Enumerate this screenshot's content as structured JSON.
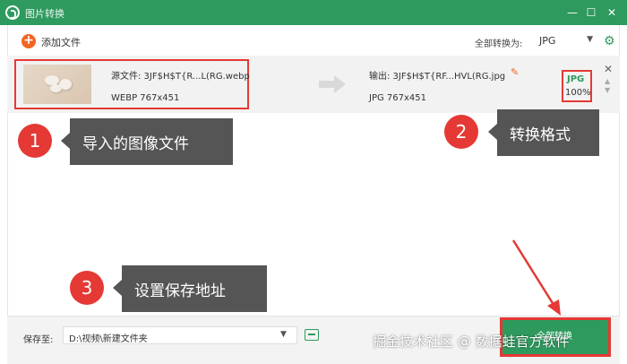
{
  "window": {
    "title": "图片转换",
    "minimize_glyph": "—",
    "maximize_glyph": "☐",
    "close_glyph": "✕"
  },
  "toolbar": {
    "add_icon_glyph": "+",
    "add_file_label": "添加文件",
    "convert_all_label": "全部转换为:",
    "format_value": "JPG",
    "format_caret": "▼",
    "settings_icon_glyph": "⚙"
  },
  "file": {
    "source_name": "源文件: 3JF$H$T{R...L(RG.webp",
    "source_meta": "WEBP   767x451",
    "output_name": "输出: 3JF$H$T{RF...HVL(RG.jpg",
    "edit_icon_glyph": "✎",
    "output_meta": "JPG   767x451",
    "format_code": "JPG",
    "quality": "100%",
    "remove_glyph": "✕",
    "spin_up_glyph": "▲",
    "spin_down_glyph": "▼"
  },
  "callouts": [
    {
      "number": "1",
      "text": "导入的图像文件"
    },
    {
      "number": "2",
      "text": "转换格式"
    },
    {
      "number": "3",
      "text": "设置保存地址"
    }
  ],
  "bottom": {
    "save_label": "保存至:",
    "save_path": "D:\\视频\\新建文件夹",
    "save_caret": "▼",
    "convert_button_label": "全部转换"
  },
  "watermark": "掘金技术社区 @ 数据蛙官方软件",
  "colors": {
    "accent_green": "#2e9a5e",
    "annotation_red": "#e53935",
    "callout_gray": "#555555",
    "add_orange": "#f26522"
  }
}
